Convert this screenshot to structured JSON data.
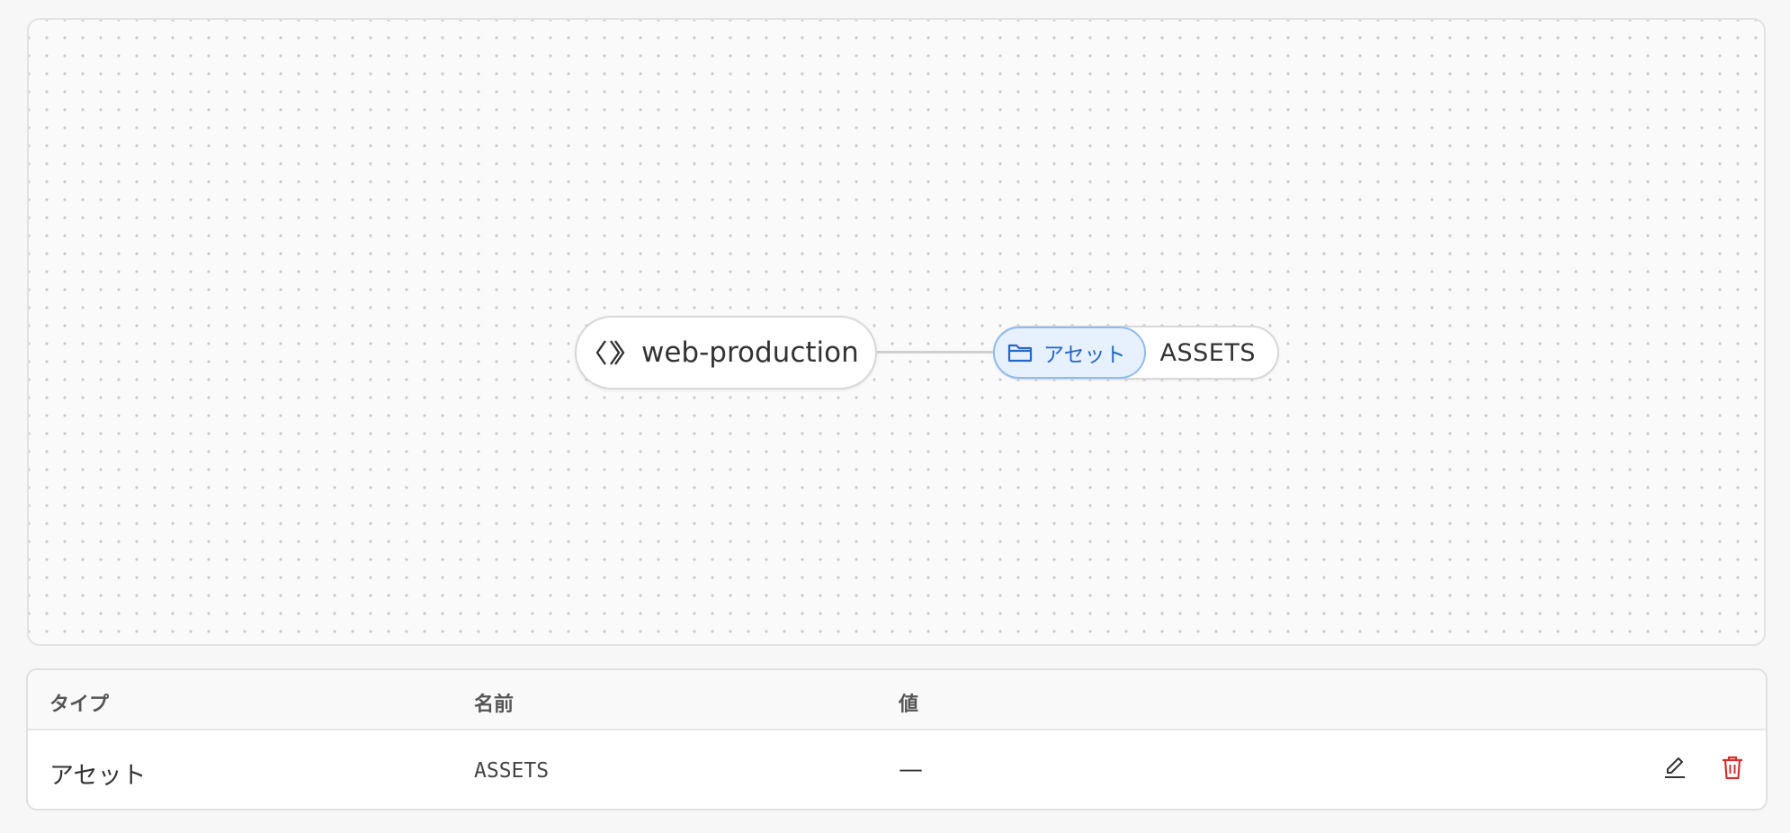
{
  "graph": {
    "root_node": {
      "label": "web-production",
      "icon": "code-brackets-icon"
    },
    "child_node": {
      "type_label": "アセット",
      "type_icon": "folder-icon",
      "name": "ASSETS",
      "accent_color": "#2566c9"
    }
  },
  "table": {
    "headers": [
      "タイプ",
      "名前",
      "値"
    ],
    "rows": [
      {
        "type": "アセット",
        "name": "ASSETS",
        "value": "—",
        "actions": [
          "edit-icon",
          "trash-icon"
        ]
      }
    ],
    "delete_color": "#d32f2f"
  }
}
